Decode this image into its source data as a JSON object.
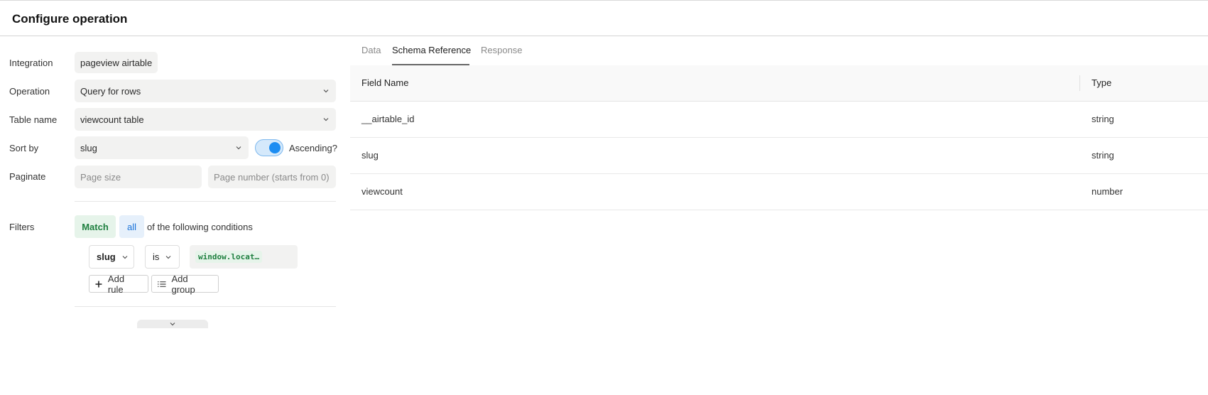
{
  "header": {
    "title": "Configure operation"
  },
  "form": {
    "integration": {
      "label": "Integration",
      "value": "pageview airtable"
    },
    "operation": {
      "label": "Operation",
      "value": "Query for rows"
    },
    "table_name": {
      "label": "Table name",
      "value": "viewcount table"
    },
    "sort_by": {
      "label": "Sort by",
      "value": "slug",
      "toggle_label": "Ascending?",
      "ascending": true
    },
    "paginate": {
      "label": "Paginate",
      "page_size_placeholder": "Page size",
      "page_number_placeholder": "Page number (starts from 0)"
    },
    "filters": {
      "label": "Filters",
      "match_label": "Match",
      "quantifier": "all",
      "suffix": "of the following conditions",
      "rule": {
        "field": "slug",
        "operator": "is",
        "value": "window.locat…"
      },
      "add_rule_label": "Add rule",
      "add_group_label": "Add group"
    }
  },
  "tabs": [
    {
      "label": "Data",
      "active": false
    },
    {
      "label": "Schema Reference",
      "active": true
    },
    {
      "label": "Response",
      "active": false
    }
  ],
  "schema_table": {
    "columns": [
      "Field Name",
      "Type"
    ],
    "rows": [
      {
        "field": "__airtable_id",
        "type": "string"
      },
      {
        "field": "slug",
        "type": "string"
      },
      {
        "field": "viewcount",
        "type": "number"
      }
    ]
  },
  "colors": {
    "accent_blue": "#1d8df2",
    "match_green": "#1e7f3f"
  }
}
